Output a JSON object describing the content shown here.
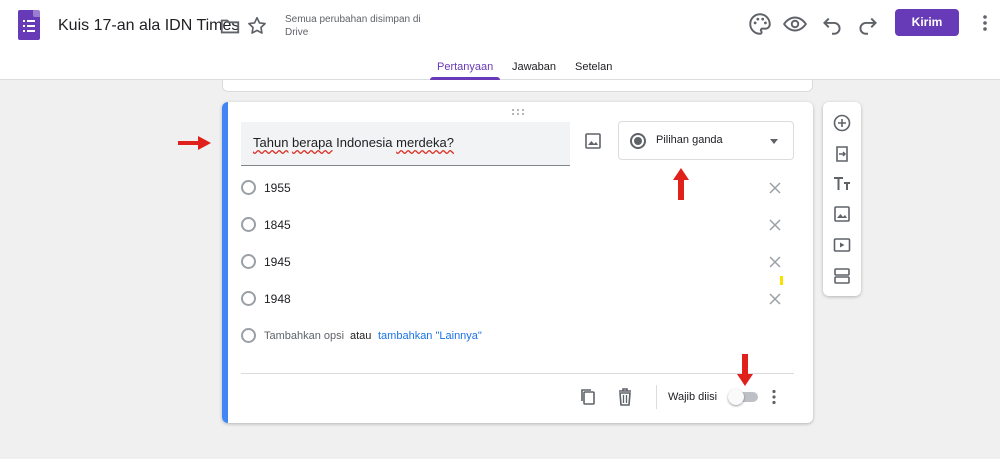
{
  "header": {
    "title": "Kuis 17-an ala IDN Times",
    "save_status": "Semua perubahan disimpan di Drive",
    "send_label": "Kirim",
    "icons": [
      "folder-icon",
      "star-icon",
      "palette-icon",
      "eye-icon",
      "undo-icon",
      "redo-icon",
      "more-vert-icon"
    ]
  },
  "tabs": [
    {
      "label": "Pertanyaan",
      "active": true
    },
    {
      "label": "Jawaban",
      "active": false
    },
    {
      "label": "Setelan",
      "active": false
    }
  ],
  "question": {
    "title_words": [
      "Tahun",
      "berapa",
      "Indonesia",
      "merdeka?"
    ],
    "type_label": "Pilihan ganda",
    "options": [
      "1955",
      "1845",
      "1945",
      "1948"
    ],
    "add_option_label": "Tambahkan opsi",
    "or_label": "atau",
    "add_other_label": "tambahkan \"Lainnya\"",
    "required_label": "Wajib diisi",
    "required": false
  },
  "side_toolbar": [
    "add-question-icon",
    "import-questions-icon",
    "add-title-icon",
    "add-image-icon",
    "add-video-icon",
    "add-section-icon"
  ],
  "colors": {
    "accent": "#673ab7",
    "focus_bar": "#4285f4",
    "annotation_arrow": "#e0201b"
  }
}
